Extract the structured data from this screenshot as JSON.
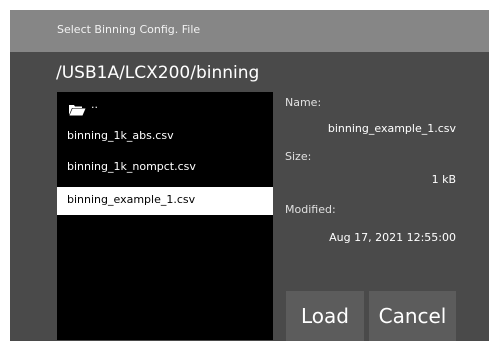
{
  "dialog": {
    "title": "Select Binning Config. File",
    "path": "/USB1A/LCX200/binning"
  },
  "file_list": {
    "parent_label": "..",
    "items": [
      {
        "label": "binning_1k_abs.csv"
      },
      {
        "label": "binning_1k_nompct.csv"
      },
      {
        "label": "binning_example_1.csv"
      }
    ]
  },
  "details": {
    "name_label": "Name:",
    "name_value": "binning_example_1.csv",
    "size_label": "Size:",
    "size_value": "1 kB",
    "modified_label": "Modified:",
    "modified_value": "Aug 17, 2021 12:55:00"
  },
  "buttons": {
    "load": "Load",
    "cancel": "Cancel"
  },
  "colors": {
    "titlebar": "#868686",
    "dialog_bg": "#4a4a4a",
    "list_bg": "#000000",
    "selected_row": "#ffffff",
    "button_bg": "#5c5c5c"
  },
  "icons": {
    "parent_folder": "open-folder-icon"
  }
}
